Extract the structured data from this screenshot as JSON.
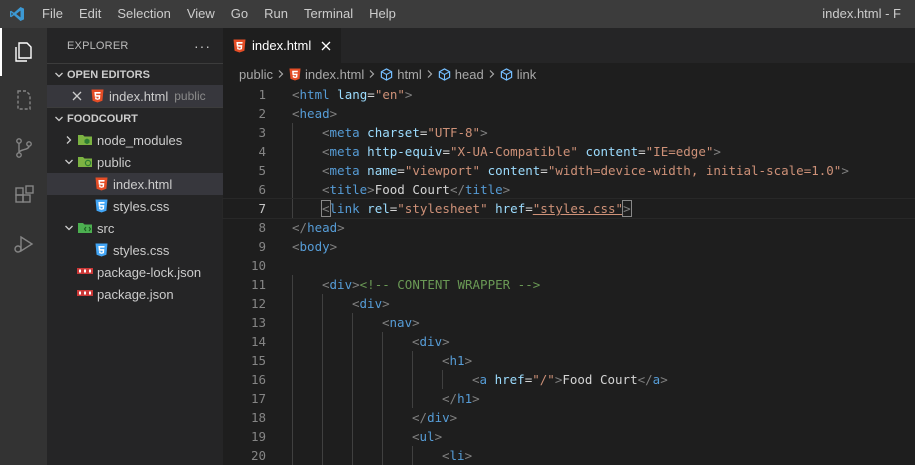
{
  "menu": [
    "File",
    "Edit",
    "Selection",
    "View",
    "Go",
    "Run",
    "Terminal",
    "Help"
  ],
  "window_title": "index.html - F",
  "sidebar": {
    "title": "EXPLORER",
    "more": "···",
    "open_editors": {
      "label": "OPEN EDITORS",
      "items": [
        {
          "name": "index.html",
          "folder": "public"
        }
      ]
    },
    "project": {
      "label": "FOODCOURT",
      "items": [
        {
          "name": "node_modules",
          "type": "folder",
          "expanded": false
        },
        {
          "name": "public",
          "type": "folder",
          "expanded": true
        },
        {
          "name": "index.html",
          "type": "html",
          "selected": true
        },
        {
          "name": "styles.css",
          "type": "css"
        },
        {
          "name": "src",
          "type": "folder",
          "expanded": true
        },
        {
          "name": "styles.css",
          "type": "css"
        },
        {
          "name": "package-lock.json",
          "type": "json"
        },
        {
          "name": "package.json",
          "type": "json"
        }
      ]
    }
  },
  "editor": {
    "tab": {
      "label": "index.html"
    },
    "breadcrumbs": [
      "public",
      "index.html",
      "html",
      "head",
      "link"
    ],
    "active_line": 7,
    "lines": [
      {
        "n": "1",
        "indent": 0,
        "tokens": [
          [
            "p",
            "<"
          ],
          [
            "t",
            "html"
          ],
          [
            "x",
            " "
          ],
          [
            "a",
            "lang"
          ],
          [
            "x",
            "="
          ],
          [
            "s",
            "\"en\""
          ],
          [
            "p",
            ">"
          ]
        ]
      },
      {
        "n": "2",
        "indent": 0,
        "tokens": [
          [
            "p",
            "<"
          ],
          [
            "t",
            "head"
          ],
          [
            "p",
            ">"
          ]
        ]
      },
      {
        "n": "3",
        "indent": 1,
        "tokens": [
          [
            "p",
            "<"
          ],
          [
            "t",
            "meta"
          ],
          [
            "x",
            " "
          ],
          [
            "a",
            "charset"
          ],
          [
            "x",
            "="
          ],
          [
            "s",
            "\"UTF-8\""
          ],
          [
            "p",
            ">"
          ]
        ]
      },
      {
        "n": "4",
        "indent": 1,
        "tokens": [
          [
            "p",
            "<"
          ],
          [
            "t",
            "meta"
          ],
          [
            "x",
            " "
          ],
          [
            "a",
            "http-equiv"
          ],
          [
            "x",
            "="
          ],
          [
            "s",
            "\"X-UA-Compatible\""
          ],
          [
            "x",
            " "
          ],
          [
            "a",
            "content"
          ],
          [
            "x",
            "="
          ],
          [
            "s",
            "\"IE=edge\""
          ],
          [
            "p",
            ">"
          ]
        ]
      },
      {
        "n": "5",
        "indent": 1,
        "tokens": [
          [
            "p",
            "<"
          ],
          [
            "t",
            "meta"
          ],
          [
            "x",
            " "
          ],
          [
            "a",
            "name"
          ],
          [
            "x",
            "="
          ],
          [
            "s",
            "\"viewport\""
          ],
          [
            "x",
            " "
          ],
          [
            "a",
            "content"
          ],
          [
            "x",
            "="
          ],
          [
            "s",
            "\"width=device-width, initial-scale=1.0\""
          ],
          [
            "p",
            ">"
          ]
        ]
      },
      {
        "n": "6",
        "indent": 1,
        "tokens": [
          [
            "p",
            "<"
          ],
          [
            "t",
            "title"
          ],
          [
            "p",
            ">"
          ],
          [
            "x",
            "Food Court"
          ],
          [
            "p",
            "</"
          ],
          [
            "t",
            "title"
          ],
          [
            "p",
            ">"
          ]
        ]
      },
      {
        "n": "7",
        "indent": 1,
        "tokens": [
          [
            "pb",
            "<"
          ],
          [
            "t",
            "link"
          ],
          [
            "x",
            " "
          ],
          [
            "a",
            "rel"
          ],
          [
            "x",
            "="
          ],
          [
            "s",
            "\"stylesheet\""
          ],
          [
            "x",
            " "
          ],
          [
            "a",
            "href"
          ],
          [
            "x",
            "="
          ],
          [
            "su",
            "\"styles.css\""
          ],
          [
            "pb",
            ">"
          ]
        ]
      },
      {
        "n": "8",
        "indent": 0,
        "tokens": [
          [
            "p",
            "</"
          ],
          [
            "t",
            "head"
          ],
          [
            "p",
            ">"
          ]
        ]
      },
      {
        "n": "9",
        "indent": 0,
        "tokens": [
          [
            "p",
            "<"
          ],
          [
            "t",
            "body"
          ],
          [
            "p",
            ">"
          ]
        ]
      },
      {
        "n": "10",
        "indent": 0,
        "tokens": []
      },
      {
        "n": "11",
        "indent": 1,
        "tokens": [
          [
            "p",
            "<"
          ],
          [
            "t",
            "div"
          ],
          [
            "p",
            ">"
          ],
          [
            "c",
            "<!-- CONTENT WRAPPER -->"
          ]
        ]
      },
      {
        "n": "12",
        "indent": 2,
        "tokens": [
          [
            "p",
            "<"
          ],
          [
            "t",
            "div"
          ],
          [
            "p",
            ">"
          ]
        ]
      },
      {
        "n": "13",
        "indent": 3,
        "tokens": [
          [
            "p",
            "<"
          ],
          [
            "t",
            "nav"
          ],
          [
            "p",
            ">"
          ]
        ]
      },
      {
        "n": "14",
        "indent": 4,
        "tokens": [
          [
            "p",
            "<"
          ],
          [
            "t",
            "div"
          ],
          [
            "p",
            ">"
          ]
        ]
      },
      {
        "n": "15",
        "indent": 5,
        "tokens": [
          [
            "p",
            "<"
          ],
          [
            "t",
            "h1"
          ],
          [
            "p",
            ">"
          ]
        ]
      },
      {
        "n": "16",
        "indent": 6,
        "tokens": [
          [
            "p",
            "<"
          ],
          [
            "t",
            "a"
          ],
          [
            "x",
            " "
          ],
          [
            "a",
            "href"
          ],
          [
            "x",
            "="
          ],
          [
            "s",
            "\"/\""
          ],
          [
            "p",
            ">"
          ],
          [
            "x",
            "Food Court"
          ],
          [
            "p",
            "</"
          ],
          [
            "t",
            "a"
          ],
          [
            "p",
            ">"
          ]
        ]
      },
      {
        "n": "17",
        "indent": 5,
        "tokens": [
          [
            "p",
            "</"
          ],
          [
            "t",
            "h1"
          ],
          [
            "p",
            ">"
          ]
        ]
      },
      {
        "n": "18",
        "indent": 4,
        "tokens": [
          [
            "p",
            "</"
          ],
          [
            "t",
            "div"
          ],
          [
            "p",
            ">"
          ]
        ]
      },
      {
        "n": "19",
        "indent": 4,
        "tokens": [
          [
            "p",
            "<"
          ],
          [
            "t",
            "ul"
          ],
          [
            "p",
            ">"
          ]
        ]
      },
      {
        "n": "20",
        "indent": 5,
        "tokens": [
          [
            "p",
            "<"
          ],
          [
            "t",
            "li"
          ],
          [
            "p",
            ">"
          ]
        ]
      }
    ]
  },
  "colors": {
    "vscode_blue": "#3c99d4",
    "html_icon": "#e44d26",
    "css_icon": "#42a5f5",
    "json_icon": "#cbcb41",
    "folder_green": "#7cb342"
  }
}
